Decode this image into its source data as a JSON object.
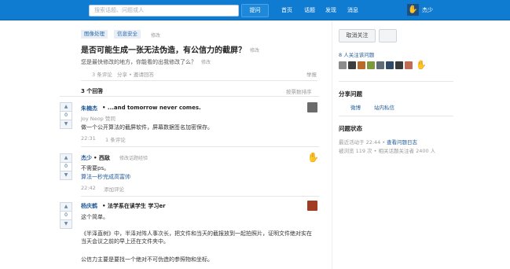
{
  "header": {
    "search_placeholder": "搜索话题、问题或人",
    "ask_label": "提问",
    "nav": [
      "首页",
      "话题",
      "发现",
      "消息"
    ],
    "user_name": "杰少"
  },
  "question": {
    "topics": [
      "图像处理",
      "信息安全"
    ],
    "topic_edit": "修改",
    "title": "是否可能生成一张无法伪造，有公信力的截屏？",
    "title_edit": "修改",
    "description": "您是最快修改的地方，你能看的出我修改了么？",
    "description_edit": "修改",
    "actions": [
      "3 条评论",
      "分享",
      "• 邀请回答"
    ],
    "report": "举报",
    "answer_count": "3 个回答",
    "sort_label": "按票数排序"
  },
  "answers": [
    {
      "vote": "0",
      "author": "朱楠杰",
      "bio": "• ...and tomorrow never comes.",
      "agree": "Joy Neop 赞同",
      "body": "做一个公开算法的截屏软件，屏幕数据签名加密保存。",
      "time": "22:31",
      "comments": "1 条评论",
      "avatar_color": "#6b6b6b"
    },
    {
      "vote": "0",
      "author": "杰少",
      "bio": "• 西敌",
      "edit_intro": "修改话题经验",
      "body": "不需要ps。",
      "extra_link": "算法一秒完成高富帅",
      "time": "22:42",
      "comments": "添加评论",
      "avatar_color": "#1e5f9e"
    },
    {
      "vote": "0",
      "author": "杨庆鹤",
      "bio": "• 法学系在读学生 学习er",
      "body": "这个简单。",
      "para1": "《半泽直树》中，半泽对阵人事次长，把文件和当天的截报放到一起拍照片，证明文件绝对实在当天会议之前的早上还在文件夹中。",
      "para2": "公信力主要是要找一个绝对不可伪造的参照物和坐标。",
      "avatar_color": "#a33b23"
    }
  ],
  "sidebar": {
    "unfollow_label": "取消关注",
    "followers_text": "8 人关注该问题",
    "share_title": "分享问题",
    "share_links": [
      "微博",
      "站内私信"
    ],
    "status_title": "问题状态",
    "status_line1_prefix": "最近活动于 22:44 •",
    "status_line1_link": "查看问题日志",
    "status_line2": "被浏览 119 次 • 相关话题关注者 2400 人"
  },
  "colors": {
    "topbar": "#0f7bd1",
    "link": "#225b99"
  }
}
